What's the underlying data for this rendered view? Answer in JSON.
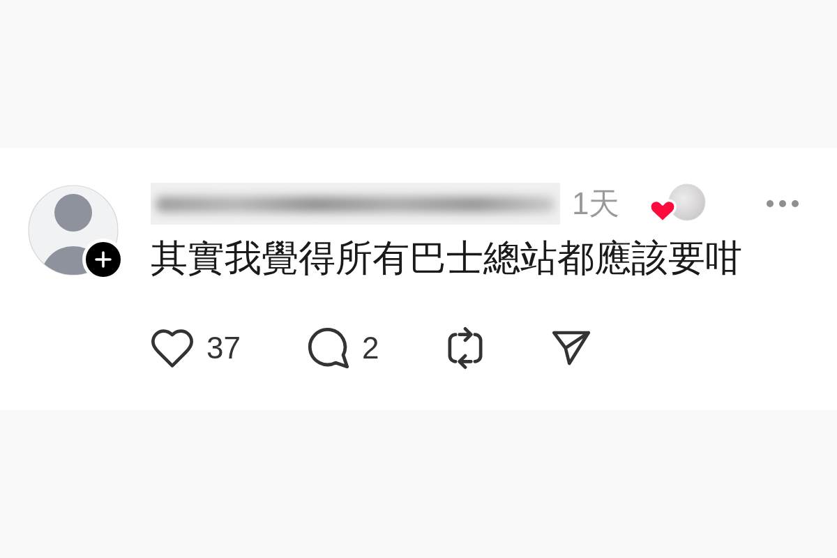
{
  "post": {
    "time": "1天",
    "text": "其實我覺得所有巴士總站都應該要咁",
    "actions": [
      {
        "kind": "like",
        "count": "37",
        "liked": false
      },
      {
        "kind": "reply",
        "count": "2"
      },
      {
        "kind": "repost"
      },
      {
        "kind": "share"
      }
    ]
  }
}
